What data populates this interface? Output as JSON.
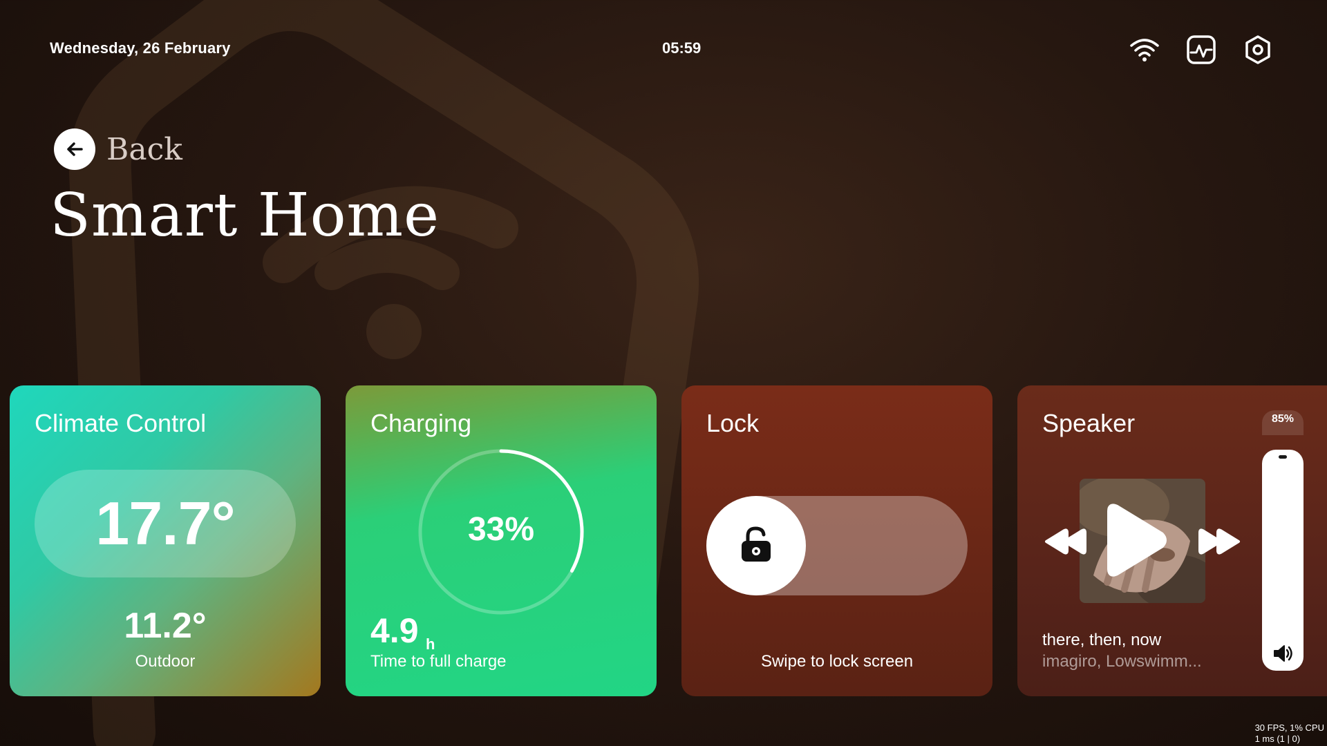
{
  "status_bar": {
    "date": "Wednesday, 26 February",
    "time": "05:59",
    "icons": [
      "wifi-icon",
      "activity-monitor-icon",
      "settings-hex-icon"
    ]
  },
  "header": {
    "back_label": "Back",
    "title": "Smart Home"
  },
  "cards": {
    "climate": {
      "title": "Climate Control",
      "indoor_temp": "17.7°",
      "outdoor_temp": "11.2°",
      "outdoor_label": "Outdoor"
    },
    "charging": {
      "title": "Charging",
      "percent_text": "33%",
      "percent_value": 0.33,
      "time_value": "4.9",
      "time_unit": "h",
      "time_label": "Time to full charge"
    },
    "lock": {
      "title": "Lock",
      "hint": "Swipe to lock screen",
      "icon": "unlocked-padlock-icon"
    },
    "speaker": {
      "title": "Speaker",
      "volume_text": "85%",
      "volume_value": 0.85,
      "track_title": "there, then, now",
      "track_artist": "imagiro, Lowswimm...",
      "controls": [
        "previous-icon",
        "play-icon",
        "next-icon"
      ]
    }
  },
  "perf": {
    "line1": "30 FPS, 1% CPU",
    "line2": "1 ms (1 | 0)"
  },
  "colors": {
    "climate_card": "#1fd7bc",
    "charging_card": "#22d585",
    "lock_card": "#6a2716",
    "speaker_card": "#58241a",
    "background": "#261710"
  }
}
